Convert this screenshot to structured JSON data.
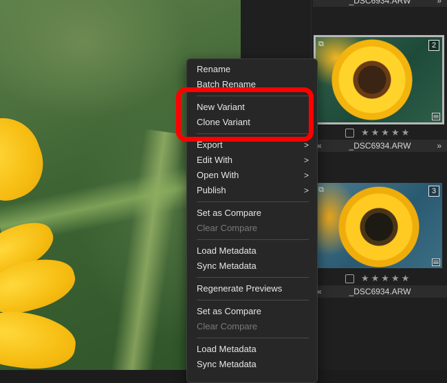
{
  "filmstrip": {
    "items": [
      {
        "filename": "_DSC6934.ARW"
      },
      {
        "filename": "_DSC6934.ARW",
        "number": "2",
        "rating_stars": "★★★★★"
      },
      {
        "filename": "_DSC6934.ARW",
        "number": "3",
        "rating_stars": "★★★★★"
      }
    ]
  },
  "context_menu": {
    "rename": "Rename",
    "batch_rename": "Batch Rename",
    "new_variant": "New Variant",
    "clone_variant": "Clone Variant",
    "export": "Export",
    "edit_with": "Edit With",
    "open_with": "Open With",
    "publish": "Publish",
    "set_as_compare_1": "Set as Compare",
    "clear_compare_1": "Clear Compare",
    "load_metadata_1": "Load Metadata",
    "sync_metadata_1": "Sync Metadata",
    "regenerate_previews": "Regenerate Previews",
    "set_as_compare_2": "Set as Compare",
    "clear_compare_2": "Clear Compare",
    "load_metadata_2": "Load Metadata",
    "sync_metadata_2": "Sync Metadata"
  },
  "highlight_color": "#ff0000"
}
